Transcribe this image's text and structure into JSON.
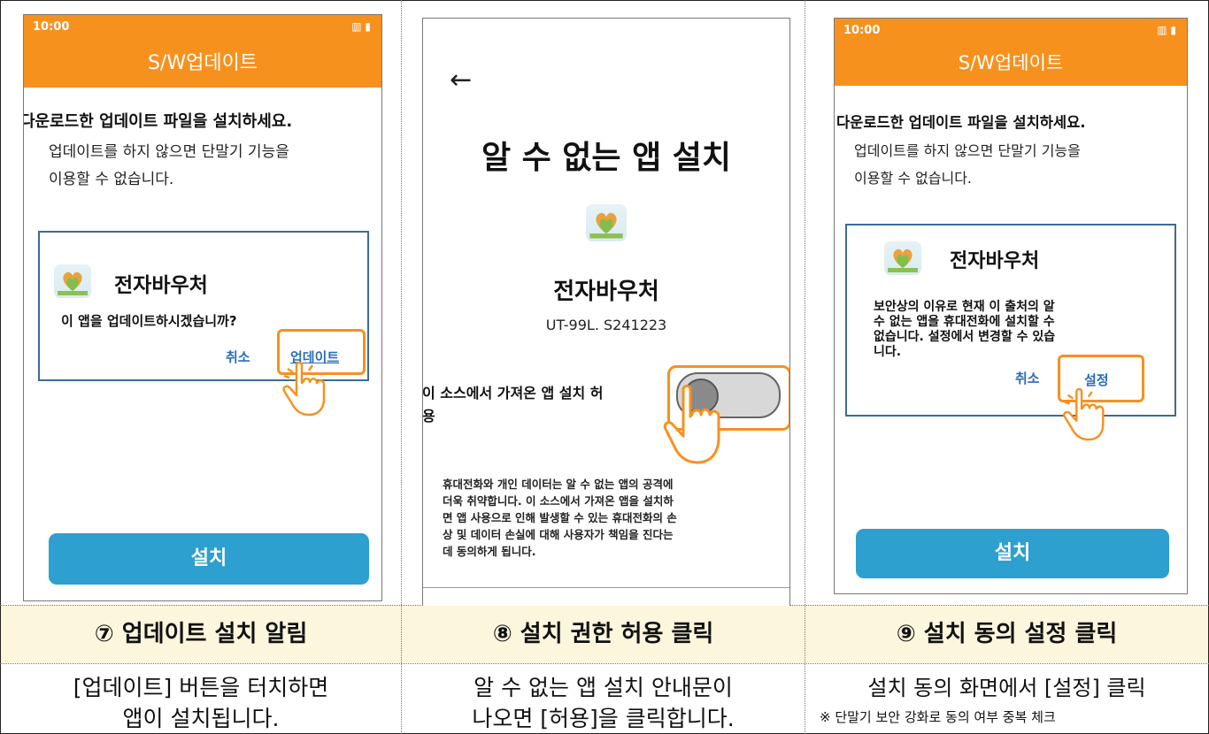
{
  "panel1": {
    "status_time": "10:00",
    "status_icons": "▥ ▮",
    "header_title": "S/W업데이트",
    "message_bold": "다운로드한 업데이트 파일을 설치하세요.",
    "message_line1": "업데이트를 하지 않으면 단말기 기능을",
    "message_line2": "이용할 수 없습니다.",
    "dialog_app_name": "전자바우처",
    "dialog_message": "이 앱을 업데이트하시겠습니까?",
    "dialog_cancel": "취소",
    "dialog_update": "업데이트",
    "install_button": "설치"
  },
  "panel2": {
    "back_arrow": "←",
    "title": "알 수 없는 앱 설치",
    "app_name": "전자바우처",
    "app_version": "UT-99L. S241223",
    "toggle_label_line1": "이 소스에서 가져온 앱 설치 허",
    "toggle_label_line2": "용",
    "toggle_state": "off",
    "warning_lines": [
      "휴대전화와 개인 데이터는 알 수 없는 앱의 공격에",
      "더욱 취약합니다. 이 소스에서 가져온 앱을 설치하",
      "면 앱 사용으로 인해 발생할 수 있는 휴대전화의 손",
      "상 및 데이터 손실에 대해 사용자가 책임을 진다는",
      "데 동의하게 됩니다."
    ]
  },
  "panel3": {
    "status_time": "10:00",
    "status_icons": "▥ ▮",
    "header_title": "S/W업데이트",
    "message_bold": "다운로드한 업데이트 파일을 설치하세요.",
    "message_line1": "업데이트를 하지 않으면 단말기 기능을",
    "message_line2": "이용할 수 없습니다.",
    "dialog_app_name": "전자바우처",
    "dialog_message_lines": [
      "보안상의 이유로 현재 이 출처의 알",
      "수 없는 앱을 휴대전화에 설치할 수",
      "없습니다. 설정에서 변경할 수 있습",
      "니다."
    ],
    "dialog_cancel": "취소",
    "dialog_settings": "설정",
    "install_button": "설치"
  },
  "captions": [
    {
      "title": "⑦ 업데이트 설치 알림",
      "desc_line1": "[업데이트] 버튼을 터치하면",
      "desc_line2": "앱이 설치됩니다."
    },
    {
      "title": "⑧ 설치 권한 허용 클릭",
      "desc_line1": "알 수 없는 앱 설치 안내문이",
      "desc_line2": "나오면 [허용]을 클릭합니다."
    },
    {
      "title": "⑨ 설치 동의 설정 클릭",
      "desc_line1": "설치 동의 화면에서 [설정] 클릭",
      "note": "※ 단말기 보안 강화로 동의 여부 중복 체크"
    }
  ],
  "colors": {
    "header_orange": "#f7911e",
    "install_blue": "#2ea0cf",
    "dialog_border": "#3e6a94",
    "link_blue": "#2b6cb8",
    "caption_bg": "#fcf6dd"
  }
}
